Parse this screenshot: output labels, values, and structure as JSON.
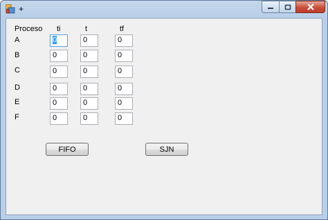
{
  "window": {
    "title": "+",
    "icon": "winforms-app-icon",
    "controls": [
      "minimize-icon",
      "maximize-icon",
      "close-icon"
    ]
  },
  "form": {
    "headers": {
      "proceso": "Proceso",
      "ti": "ti",
      "t": "t",
      "tf": "tf"
    },
    "rows": [
      {
        "label": "A",
        "ti": "0",
        "t": "0",
        "tf": "0"
      },
      {
        "label": "B",
        "ti": "0",
        "t": "0",
        "tf": "0"
      },
      {
        "label": "C",
        "ti": "0",
        "t": "0",
        "tf": "0"
      },
      {
        "label": "D",
        "ti": "0",
        "t": "0",
        "tf": "0"
      },
      {
        "label": "E",
        "ti": "0",
        "t": "0",
        "tf": "0"
      },
      {
        "label": "F",
        "ti": "0",
        "t": "0",
        "tf": "0"
      }
    ],
    "buttons": {
      "fifo": "FIFO",
      "sjn": "SJN"
    }
  }
}
